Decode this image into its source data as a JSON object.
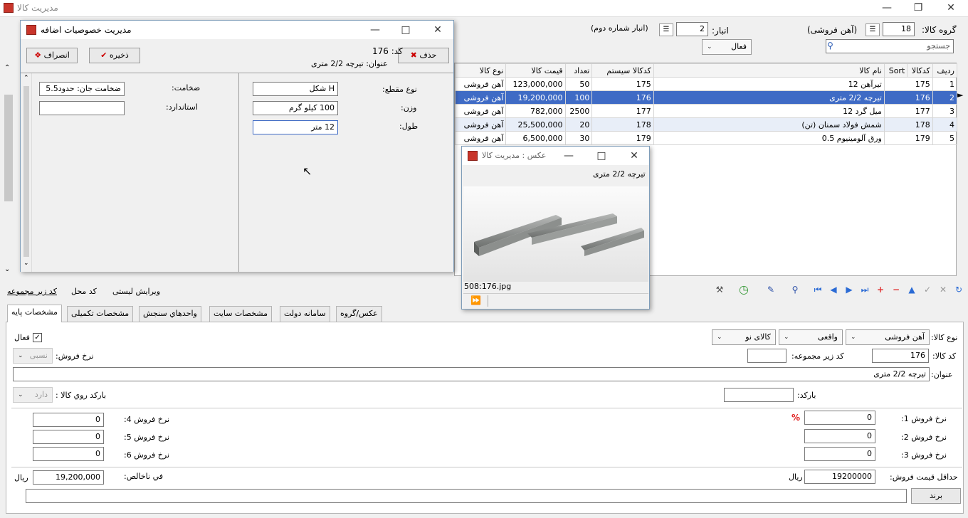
{
  "app": {
    "title": "مدیریت کالا"
  },
  "header": {
    "group_label": "گروه کالا:",
    "group_value": "18",
    "group_name": "(آهن فروشی)",
    "store_label": "انبار:",
    "store_value": "2",
    "store_name": "(انبار شماره دوم)",
    "search_placeholder": "جستجو",
    "status_combo": "فعال"
  },
  "grid": {
    "columns": [
      "رديف",
      "کدکالا",
      "Sort",
      "نام کالا",
      "کدکالا سیستم",
      "تعداد",
      "قیمت کالا",
      "نوع کالا"
    ],
    "rows": [
      {
        "row": "1",
        "code": "175",
        "name": "تیرآهن 12",
        "sys": "175",
        "qty": "50",
        "price": "123,000,000",
        "type": "آهن فروشی"
      },
      {
        "row": "2",
        "code": "176",
        "name": "تیرچه 2/2 متری",
        "sys": "176",
        "qty": "100",
        "price": "19,200,000",
        "type": "آهن فروشی"
      },
      {
        "row": "3",
        "code": "177",
        "name": "میل گرد 12",
        "sys": "177",
        "qty": "2500",
        "price": "782,000",
        "type": "آهن فروشی"
      },
      {
        "row": "4",
        "code": "178",
        "name": "شمش فولاد سمنان (تن)",
        "sys": "178",
        "qty": "20",
        "price": "25,500,000",
        "type": "آهن فروشی"
      },
      {
        "row": "5",
        "code": "179",
        "name": "ورق آلومینیوم 0.5",
        "sys": "179",
        "qty": "30",
        "price": "6,500,000",
        "type": "آهن فروشی"
      }
    ]
  },
  "dialog": {
    "title": "مدیریت خصوصیات اضافه",
    "delete": "حذف",
    "save": "ذخیره",
    "cancel": "انصراف",
    "code_label": "کد:",
    "code_value": "176",
    "title_label": "عنوان:",
    "title_value": "تیرچه 2/2 متری",
    "section_label": "نوع مقطع:",
    "section_value": "H شکل",
    "weight_label": "وزن:",
    "weight_value": "100 کیلو گرم",
    "length_label": "طول:",
    "length_value": "12 متر",
    "thickness_label": "ضخامت:",
    "thickness_value": "ضخامت جان: حدود5.5",
    "standard_label": "استاندارد:",
    "standard_value": ""
  },
  "image_window": {
    "title": "عکس : مدیریت کالا",
    "caption": "تیرچه 2/2 متری",
    "filename": "508:176.jpg"
  },
  "toolbar_links": {
    "sub_code": "کد زیر مجموعه",
    "location_code": "کد محل",
    "list_edit": "ویرایش لیستی"
  },
  "tabs": [
    "مشخصات پایه",
    "مشخصات تکمیلی",
    "واحدهاي سنجش",
    "مشخصات سایت",
    "سامانه دولت",
    "عکس/گروه"
  ],
  "form": {
    "type_label": "نوع کالا:",
    "type_value": "آهن فروشی",
    "kind_value": "واقعی",
    "new_value": "کالای نو",
    "active_label": "فعال",
    "code_label": "کد کالا:",
    "code_value": "176",
    "subgroup_label": "کد زیر مجموعه:",
    "subgroup_value": "",
    "sale_rate_label": "نرخ فروش:",
    "sale_rate_value": "نسبی",
    "title_label": "عنوان:",
    "title_value": "تیرچه 2/2 متری",
    "barcode_label": "بارکد:",
    "barcode_value": "",
    "barcode_on_label": "بارکد روي کالا :",
    "barcode_on_value": "دارد",
    "rate1_label": "نرخ فروش 1:",
    "rate1_value": "0",
    "rate2_label": "نرخ فروش 2:",
    "rate2_value": "0",
    "rate3_label": "نرخ فروش 3:",
    "rate3_value": "0",
    "rate4_label": "نرخ فروش 4:",
    "rate4_value": "0",
    "rate5_label": "نرخ فروش 5:",
    "rate5_value": "0",
    "rate6_label": "نرخ فروش 6:",
    "rate6_value": "0",
    "percent": "%",
    "min_price_label": "حداقل قیمت فروش:",
    "min_price_value": "19200000",
    "rial": "ریال",
    "gross_label": "في ناخالص:",
    "gross_value": "19,200,000",
    "brand_label": "برند"
  }
}
